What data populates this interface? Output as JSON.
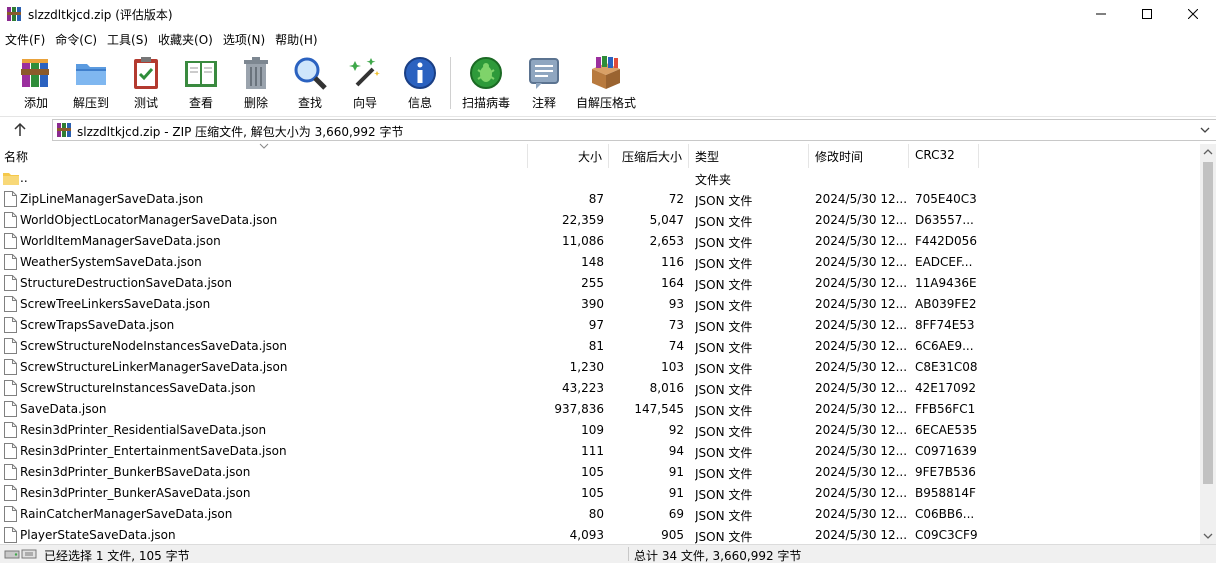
{
  "window": {
    "title": "slzzdltkjcd.zip (评估版本)",
    "minimize_glyph": "—",
    "maximize_glyph": "☐",
    "close_glyph": "✕"
  },
  "menu": [
    "文件(F)",
    "命令(C)",
    "工具(S)",
    "收藏夹(O)",
    "选项(N)",
    "帮助(H)"
  ],
  "toolbar": [
    {
      "label": "添加",
      "icon": "winrar-add-icon"
    },
    {
      "label": "解压到",
      "icon": "extract-folder-icon"
    },
    {
      "label": "测试",
      "icon": "test-clipboard-icon"
    },
    {
      "label": "查看",
      "icon": "view-book-icon"
    },
    {
      "label": "删除",
      "icon": "trash-can-icon"
    },
    {
      "label": "查找",
      "icon": "magnifier-icon"
    },
    {
      "label": "向导",
      "icon": "magic-wand-icon"
    },
    {
      "label": "信息",
      "icon": "info-icon"
    },
    {
      "label": "扫描病毒",
      "icon": "virus-scan-icon"
    },
    {
      "label": "注释",
      "icon": "comment-icon"
    },
    {
      "label": "自解压格式",
      "icon": "sfx-box-icon"
    }
  ],
  "address": {
    "path": "slzzdltkjcd.zip - ZIP 压缩文件, 解包大小为 3,660,992 字节"
  },
  "columns": {
    "name": "名称",
    "size": "大小",
    "packed": "压缩后大小",
    "type": "类型",
    "modified": "修改时间",
    "crc": "CRC32"
  },
  "files": [
    {
      "name": "..",
      "size": "",
      "packed": "",
      "type": "文件夹",
      "modified": "",
      "crc": "",
      "icon": "folder-icon"
    },
    {
      "name": "ZipLineManagerSaveData.json",
      "size": "87",
      "packed": "72",
      "type": "JSON 文件",
      "modified": "2024/5/30 12...",
      "crc": "705E40C3",
      "icon": "file-icon"
    },
    {
      "name": "WorldObjectLocatorManagerSaveData.json",
      "size": "22,359",
      "packed": "5,047",
      "type": "JSON 文件",
      "modified": "2024/5/30 12...",
      "crc": "D63557...",
      "icon": "file-icon"
    },
    {
      "name": "WorldItemManagerSaveData.json",
      "size": "11,086",
      "packed": "2,653",
      "type": "JSON 文件",
      "modified": "2024/5/30 12...",
      "crc": "F442D056",
      "icon": "file-icon"
    },
    {
      "name": "WeatherSystemSaveData.json",
      "size": "148",
      "packed": "116",
      "type": "JSON 文件",
      "modified": "2024/5/30 12...",
      "crc": "EADCEF...",
      "icon": "file-icon"
    },
    {
      "name": "StructureDestructionSaveData.json",
      "size": "255",
      "packed": "164",
      "type": "JSON 文件",
      "modified": "2024/5/30 12...",
      "crc": "11A9436E",
      "icon": "file-icon"
    },
    {
      "name": "ScrewTreeLinkersSaveData.json",
      "size": "390",
      "packed": "93",
      "type": "JSON 文件",
      "modified": "2024/5/30 12...",
      "crc": "AB039FE2",
      "icon": "file-icon"
    },
    {
      "name": "ScrewTrapsSaveData.json",
      "size": "97",
      "packed": "73",
      "type": "JSON 文件",
      "modified": "2024/5/30 12...",
      "crc": "8FF74E53",
      "icon": "file-icon"
    },
    {
      "name": "ScrewStructureNodeInstancesSaveData.json",
      "size": "81",
      "packed": "74",
      "type": "JSON 文件",
      "modified": "2024/5/30 12...",
      "crc": "6C6AE9...",
      "icon": "file-icon"
    },
    {
      "name": "ScrewStructureLinkerManagerSaveData.json",
      "size": "1,230",
      "packed": "103",
      "type": "JSON 文件",
      "modified": "2024/5/30 12...",
      "crc": "C8E31C08",
      "icon": "file-icon"
    },
    {
      "name": "ScrewStructureInstancesSaveData.json",
      "size": "43,223",
      "packed": "8,016",
      "type": "JSON 文件",
      "modified": "2024/5/30 12...",
      "crc": "42E17092",
      "icon": "file-icon"
    },
    {
      "name": "SaveData.json",
      "size": "937,836",
      "packed": "147,545",
      "type": "JSON 文件",
      "modified": "2024/5/30 12...",
      "crc": "FFB56FC1",
      "icon": "file-icon"
    },
    {
      "name": "Resin3dPrinter_ResidentialSaveData.json",
      "size": "109",
      "packed": "92",
      "type": "JSON 文件",
      "modified": "2024/5/30 12...",
      "crc": "6ECAE535",
      "icon": "file-icon"
    },
    {
      "name": "Resin3dPrinter_EntertainmentSaveData.json",
      "size": "111",
      "packed": "94",
      "type": "JSON 文件",
      "modified": "2024/5/30 12...",
      "crc": "C0971639",
      "icon": "file-icon"
    },
    {
      "name": "Resin3dPrinter_BunkerBSaveData.json",
      "size": "105",
      "packed": "91",
      "type": "JSON 文件",
      "modified": "2024/5/30 12...",
      "crc": "9FE7B536",
      "icon": "file-icon"
    },
    {
      "name": "Resin3dPrinter_BunkerASaveData.json",
      "size": "105",
      "packed": "91",
      "type": "JSON 文件",
      "modified": "2024/5/30 12...",
      "crc": "B958814F",
      "icon": "file-icon"
    },
    {
      "name": "RainCatcherManagerSaveData.json",
      "size": "80",
      "packed": "69",
      "type": "JSON 文件",
      "modified": "2024/5/30 12...",
      "crc": "C06BB6...",
      "icon": "file-icon"
    },
    {
      "name": "PlayerStateSaveData.json",
      "size": "4,093",
      "packed": "905",
      "type": "JSON 文件",
      "modified": "2024/5/30 12...",
      "crc": "C09C3CF9",
      "icon": "file-icon"
    }
  ],
  "status": {
    "selection": "已经选择 1 文件, 105 字节",
    "total": "总计 34 文件, 3,660,992 字节"
  },
  "colors": {
    "folder": "#f5c84a",
    "scroll_thumb": "#c2c2c2",
    "statusbar": "#f0f0f0"
  }
}
